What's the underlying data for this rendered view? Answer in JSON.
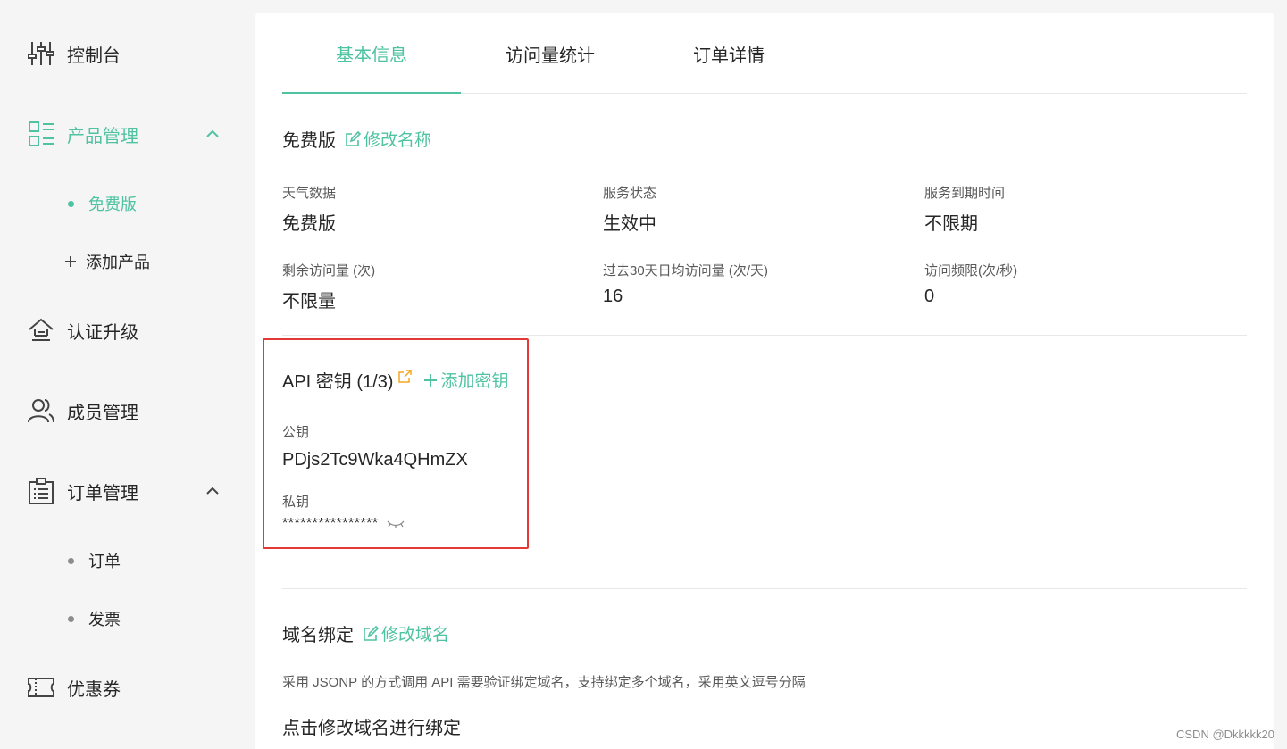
{
  "sidebar": {
    "items": [
      {
        "id": "dashboard",
        "label": "控制台",
        "icon": "sliders-icon"
      },
      {
        "id": "product",
        "label": "产品管理",
        "icon": "list-grid-icon"
      },
      {
        "id": "upgrade",
        "label": "认证升级",
        "icon": "upgrade-home-icon"
      },
      {
        "id": "members",
        "label": "成员管理",
        "icon": "users-icon"
      },
      {
        "id": "orders",
        "label": "订单管理",
        "icon": "clipboard-icon"
      },
      {
        "id": "coupons",
        "label": "优惠券",
        "icon": "ticket-icon"
      }
    ],
    "product_sub": [
      {
        "label": "免费版"
      },
      {
        "label": "添加产品"
      }
    ],
    "orders_sub": [
      {
        "label": "订单"
      },
      {
        "label": "发票"
      }
    ]
  },
  "tabs": [
    {
      "label": "基本信息"
    },
    {
      "label": "访问量统计"
    },
    {
      "label": "订单详情"
    }
  ],
  "plan": {
    "title": "免费版",
    "rename_label": "修改名称",
    "fields": [
      {
        "label": "天气数据",
        "value": "免费版"
      },
      {
        "label": "服务状态",
        "value": "生效中"
      },
      {
        "label": "服务到期时间",
        "value": "不限期"
      },
      {
        "label": "剩余访问量 (次)",
        "value": "不限量"
      },
      {
        "label": "过去30天日均访问量 (次/天)",
        "value": "16"
      },
      {
        "label": "访问频限(次/秒)",
        "value": "0"
      }
    ]
  },
  "api": {
    "title": "API 密钥 (1/3)",
    "add_label": "添加密钥",
    "public_label": "公钥",
    "public_value": "PDjs2Tc9Wka4QHmZX",
    "private_label": "私钥",
    "private_value": "****************"
  },
  "domain": {
    "title": "域名绑定",
    "edit_label": "修改域名",
    "description": "采用 JSONP 的方式调用 API 需要验证绑定域名，支持绑定多个域名，采用英文逗号分隔",
    "hint": "点击修改域名进行绑定"
  },
  "watermark": "CSDN @Dkkkkk20",
  "colors": {
    "accent": "#4fc3a1",
    "highlight_border": "#e53935",
    "external_link": "#f5a623"
  }
}
